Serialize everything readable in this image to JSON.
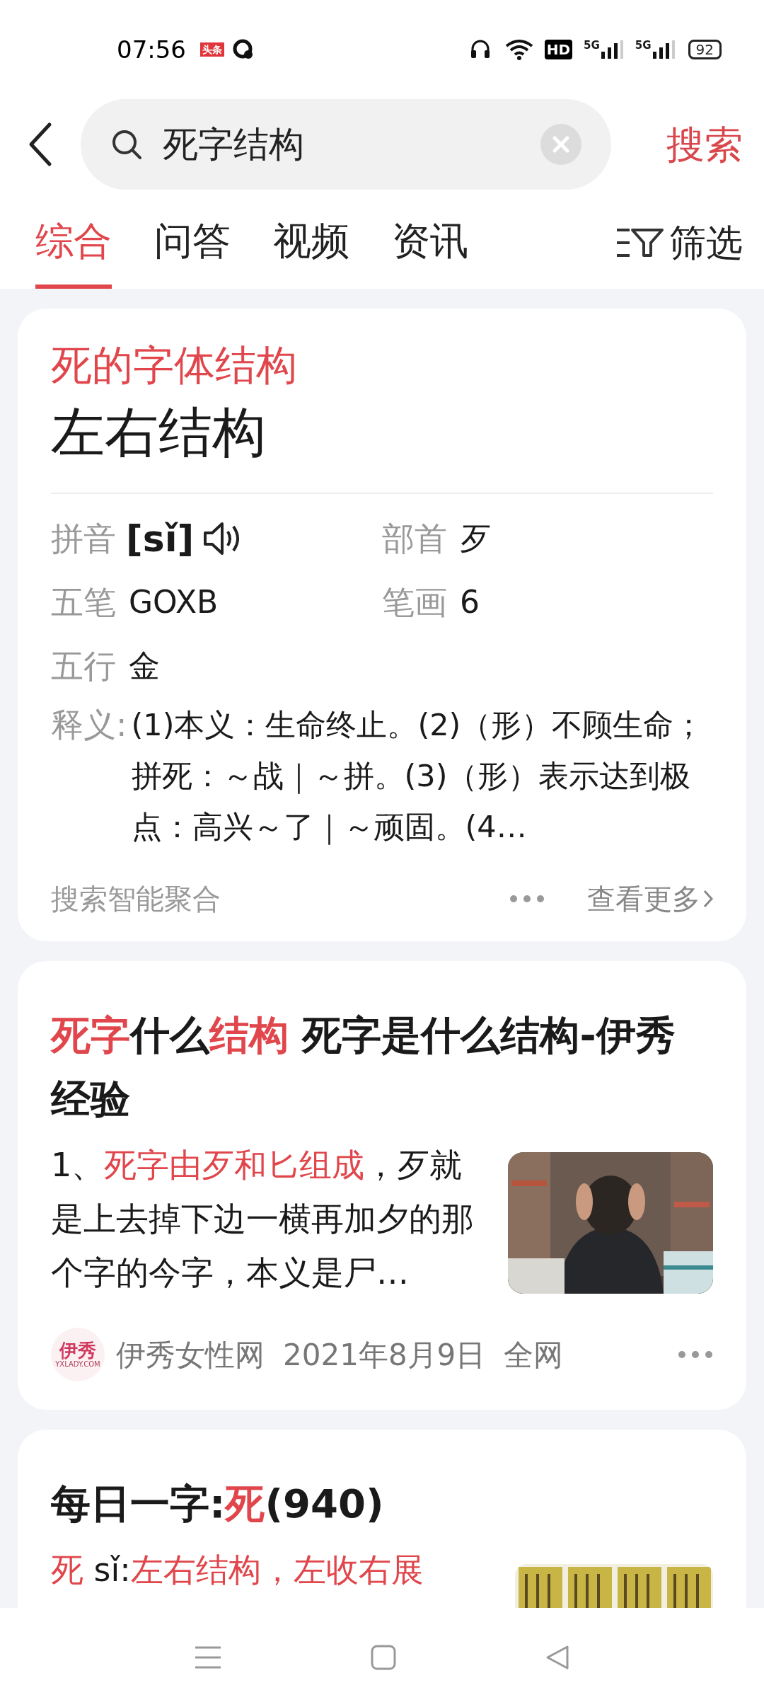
{
  "status_bar": {
    "time": "07:56",
    "app_badge": "头条",
    "hd_badge": "HD",
    "network_1": "5G",
    "network_2": "5G",
    "battery": "92"
  },
  "search": {
    "value": "死字结构",
    "action": "搜索"
  },
  "tabs": [
    {
      "label": "综合",
      "selected": true
    },
    {
      "label": "问答",
      "selected": false
    },
    {
      "label": "视频",
      "selected": false
    },
    {
      "label": "资讯",
      "selected": false
    }
  ],
  "filter": "筛选",
  "dictionary_card": {
    "subtitle": "死的字体结构",
    "answer": "左右结构",
    "fields": [
      {
        "label": "拼音",
        "value": "[sǐ]",
        "kind": "pinyin"
      },
      {
        "label": "部首",
        "value": "歹",
        "kind": "text"
      },
      {
        "label": "五笔",
        "value": "GOXB",
        "kind": "text"
      },
      {
        "label": "笔画",
        "value": "6",
        "kind": "text"
      },
      {
        "label": "五行",
        "value": "金",
        "kind": "text"
      }
    ],
    "definition_label": "释义:",
    "definition": "(1)本义：生命终止。(2)（形）不顾生命；拼死：～战｜～拼。(3)（形）表示达到极点：高兴～了｜～顽固。(4…",
    "source": "搜索智能聚合",
    "more": "查看更多"
  },
  "results": [
    {
      "title": [
        {
          "text": "死字",
          "highlight": true
        },
        {
          "text": "什么",
          "highlight": false
        },
        {
          "text": "结构",
          "highlight": true
        },
        {
          "text": " 死字是什么结构-伊秀经验",
          "highlight": false
        }
      ],
      "snippet": [
        {
          "text": "1、",
          "highlight": false
        },
        {
          "text": "死字由歹和匕组成",
          "highlight": true
        },
        {
          "text": "，歹就是上去掉下边一横再加夕的那个字的今字，本义是尸…",
          "highlight": false
        }
      ],
      "source_logo": "伊秀",
      "source_logo_caption": "YXLADY.COM",
      "source": "伊秀女性网",
      "date": "2021年8月9日",
      "scope": "全网",
      "picture": {
        "kind": "picture"
      }
    },
    {
      "title": [
        {
          "text": "每日一字:",
          "highlight": false
        },
        {
          "text": "死",
          "highlight": true
        },
        {
          "text": "(940)",
          "highlight": false
        }
      ],
      "snippet": [
        {
          "text": "死",
          "highlight": true
        },
        {
          "text": " sǐ:",
          "highlight": false
        },
        {
          "text": "左右结构，左收右展",
          "highlight": true
        }
      ],
      "picture": {
        "kind": "picture"
      }
    }
  ]
}
